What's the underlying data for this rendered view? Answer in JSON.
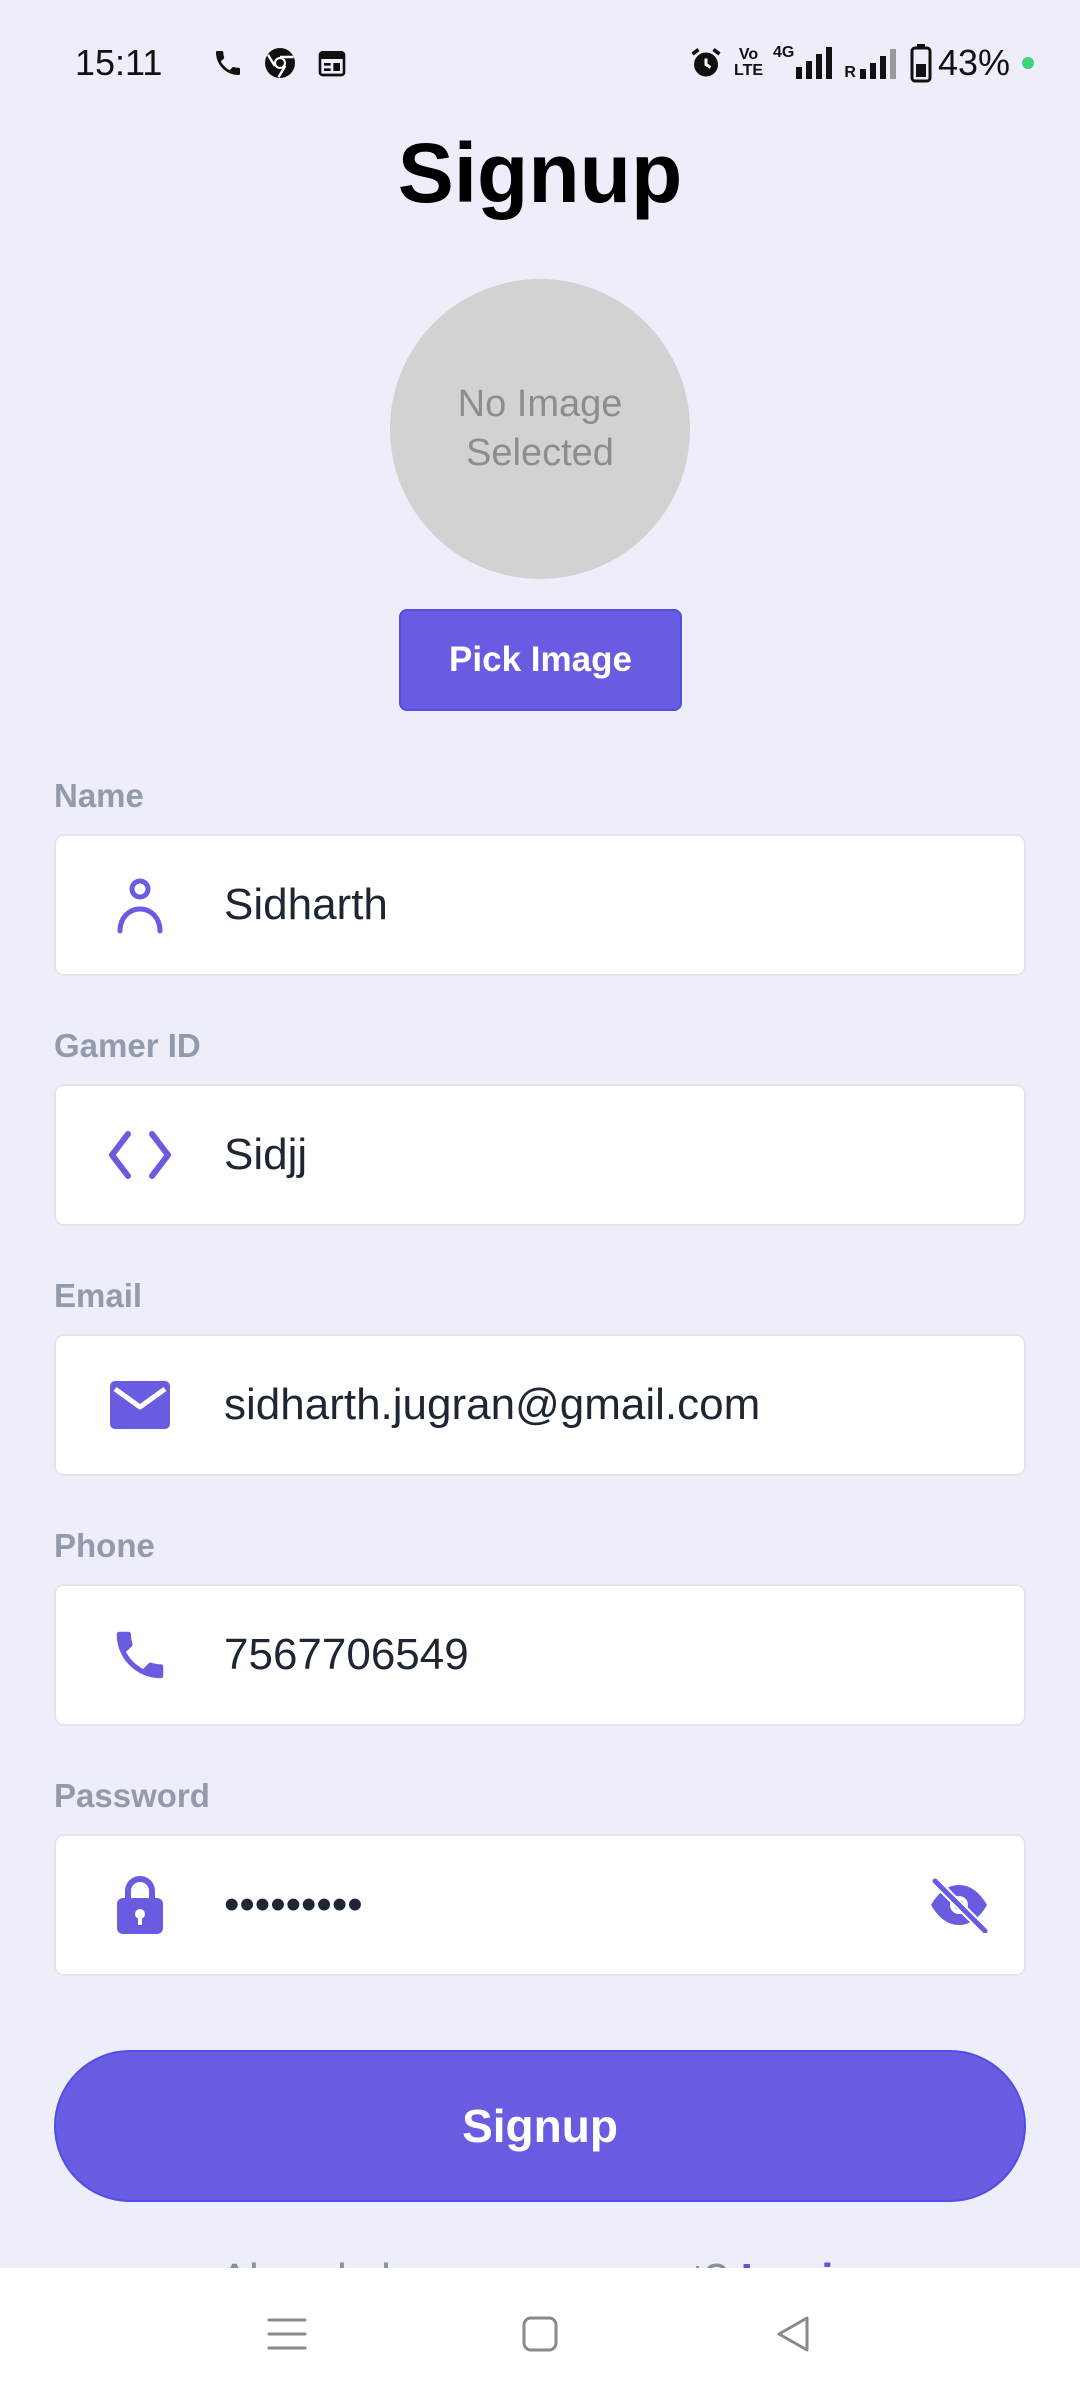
{
  "status_bar": {
    "time": "15:11",
    "left_icons": [
      "phone-icon",
      "chrome-icon",
      "calendar-icon"
    ],
    "right_icons": [
      "alarm-icon",
      "volte-icon",
      "signal-4g-icon",
      "signal-roaming-icon",
      "battery-icon"
    ],
    "volte_text_1": "Vo",
    "volte_text_2": "LTE",
    "network_label": "4G",
    "roaming_label": "R",
    "battery_percent": "43%",
    "dot_color": "#3ad57a"
  },
  "page": {
    "title": "Signup"
  },
  "avatar": {
    "placeholder_text": "No Image Selected"
  },
  "pick_image_button": {
    "label": "Pick Image"
  },
  "form": {
    "fields": [
      {
        "label": "Name",
        "value": "Sidharth",
        "icon": "person-icon"
      },
      {
        "label": "Gamer ID",
        "value": "Sidjj",
        "icon": "code-icon"
      },
      {
        "label": "Email",
        "value": "sidharth.jugran@gmail.com",
        "icon": "mail-icon"
      },
      {
        "label": "Phone",
        "value": "7567706549",
        "icon": "phone-icon"
      },
      {
        "label": "Password",
        "value": "•••••••••",
        "icon": "lock-icon",
        "toggle_icon": "eye-off-icon"
      }
    ]
  },
  "signup_button": {
    "label": "Signup"
  },
  "footer": {
    "prompt": "Already have an account?",
    "link": "Login"
  },
  "nav": {
    "icons": [
      "menu-icon",
      "home-icon",
      "back-icon"
    ]
  },
  "colors": {
    "accent": "#6a5ce0",
    "background": "#eeedfa",
    "label": "#939aab"
  }
}
